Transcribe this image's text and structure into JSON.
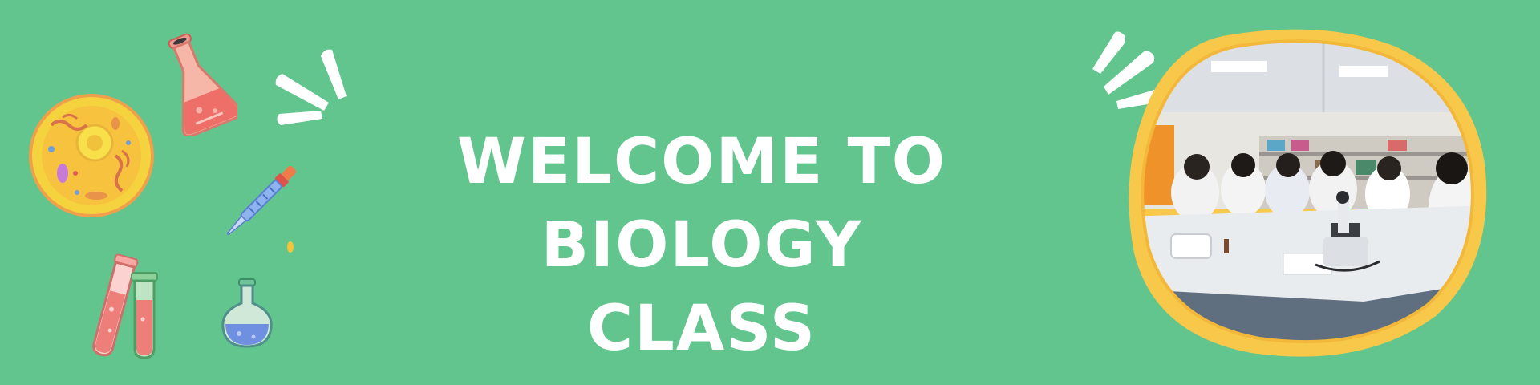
{
  "title": {
    "line1": "WELCOME TO BIOLOGY",
    "line2": "CLASS"
  },
  "colors": {
    "background": "#61c58d",
    "title_text": "#ffffff",
    "photo_frame": "#f7c84a",
    "cell_yellow": "#f5d33f",
    "flask_pink": "#ee8c86",
    "flask_blue": "#6f8fe0"
  },
  "icons": [
    "animal-cell-icon",
    "erlenmeyer-flask-icon",
    "pipette-icon",
    "test-tube-pink-icon",
    "test-tube-green-icon",
    "round-flask-icon",
    "burst-lines-icon",
    "classroom-photo"
  ]
}
